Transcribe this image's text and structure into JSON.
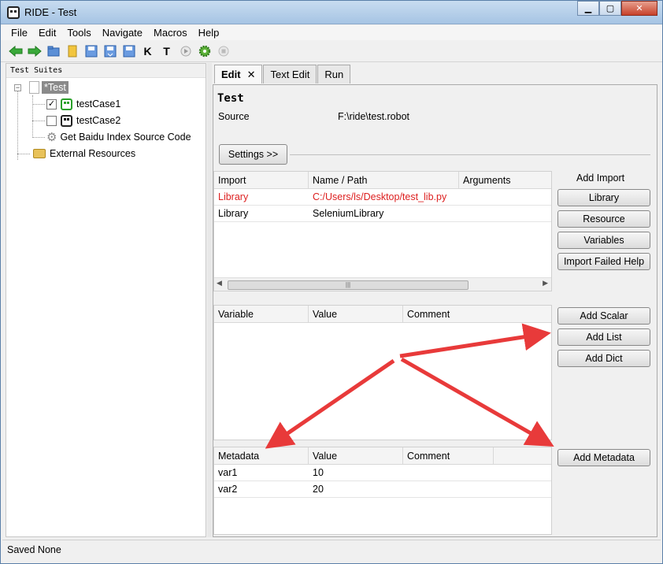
{
  "window": {
    "title": "RIDE - Test",
    "minimize": "▁",
    "maximize": "▢",
    "close": "✕"
  },
  "menu": [
    "File",
    "Edit",
    "Tools",
    "Navigate",
    "Macros",
    "Help"
  ],
  "toolbar_icons": [
    "back-arrow-icon",
    "forward-arrow-icon",
    "open-folder-icon",
    "open-directory-icon",
    "save-icon",
    "save-all-icon",
    "export-icon",
    "search-keywords-icon",
    "search-tests-icon",
    "run-icon",
    "debug-gear-icon",
    "stop-icon"
  ],
  "toolbar_glyphs": {
    "k": "K",
    "t": "T"
  },
  "tree": {
    "header": "Test Suites",
    "suite": {
      "label": "*Test",
      "expander": "−"
    },
    "items": [
      {
        "label": "testCase1",
        "checked": true,
        "check_mark": "✓"
      },
      {
        "label": "testCase2",
        "checked": false,
        "check_mark": ""
      },
      {
        "label": "Get Baidu Index Source Code"
      }
    ],
    "external": "External Resources"
  },
  "tabs": [
    {
      "label": "Edit",
      "active": true,
      "close": "✕"
    },
    {
      "label": "Text Edit",
      "active": false
    },
    {
      "label": "Run",
      "active": false
    }
  ],
  "editor": {
    "title": "Test",
    "source_label": "Source",
    "source_value": "F:\\ride\\test.robot",
    "settings_button": "Settings >>"
  },
  "imports": {
    "headers": [
      "Import",
      "Name / Path",
      "Arguments"
    ],
    "rows": [
      {
        "type": "Library",
        "path": "C:/Users/ls/Desktop/test_lib.py",
        "error": true
      },
      {
        "type": "Library",
        "path": "SeleniumLibrary",
        "error": false
      }
    ],
    "add_label": "Add Import",
    "buttons": [
      "Library",
      "Resource",
      "Variables",
      "Import Failed Help"
    ],
    "scroll_grip": "|||",
    "scroll_left": "◀",
    "scroll_right": "▶"
  },
  "variables": {
    "headers": [
      "Variable",
      "Value",
      "Comment"
    ],
    "buttons": [
      "Add Scalar",
      "Add List",
      "Add Dict"
    ]
  },
  "metadata": {
    "headers": [
      "Metadata",
      "Value",
      "Comment"
    ],
    "rows": [
      {
        "name": "var1",
        "value": "10"
      },
      {
        "name": "var2",
        "value": "20"
      }
    ],
    "button": "Add Metadata"
  },
  "status": "Saved None",
  "colors": {
    "error_text": "#dd2020",
    "arrow": "#e83a3a",
    "selected_node": "#8a8a8a"
  }
}
